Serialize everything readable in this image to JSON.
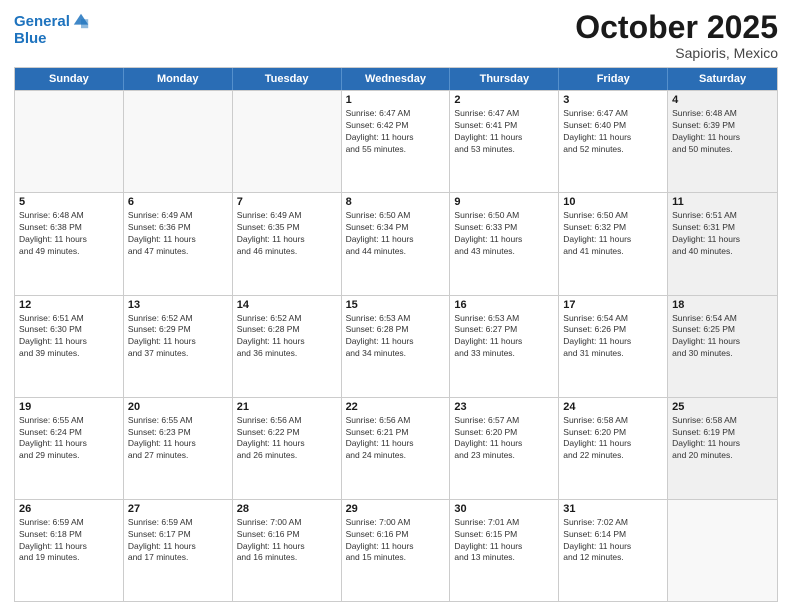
{
  "header": {
    "logo_line1": "General",
    "logo_line2": "Blue",
    "title": "October 2025",
    "subtitle": "Sapioris, Mexico"
  },
  "days_of_week": [
    "Sunday",
    "Monday",
    "Tuesday",
    "Wednesday",
    "Thursday",
    "Friday",
    "Saturday"
  ],
  "weeks": [
    [
      {
        "day": "",
        "info": "",
        "empty": true
      },
      {
        "day": "",
        "info": "",
        "empty": true
      },
      {
        "day": "",
        "info": "",
        "empty": true
      },
      {
        "day": "1",
        "info": "Sunrise: 6:47 AM\nSunset: 6:42 PM\nDaylight: 11 hours\nand 55 minutes."
      },
      {
        "day": "2",
        "info": "Sunrise: 6:47 AM\nSunset: 6:41 PM\nDaylight: 11 hours\nand 53 minutes."
      },
      {
        "day": "3",
        "info": "Sunrise: 6:47 AM\nSunset: 6:40 PM\nDaylight: 11 hours\nand 52 minutes."
      },
      {
        "day": "4",
        "info": "Sunrise: 6:48 AM\nSunset: 6:39 PM\nDaylight: 11 hours\nand 50 minutes.",
        "shaded": true
      }
    ],
    [
      {
        "day": "5",
        "info": "Sunrise: 6:48 AM\nSunset: 6:38 PM\nDaylight: 11 hours\nand 49 minutes."
      },
      {
        "day": "6",
        "info": "Sunrise: 6:49 AM\nSunset: 6:36 PM\nDaylight: 11 hours\nand 47 minutes."
      },
      {
        "day": "7",
        "info": "Sunrise: 6:49 AM\nSunset: 6:35 PM\nDaylight: 11 hours\nand 46 minutes."
      },
      {
        "day": "8",
        "info": "Sunrise: 6:50 AM\nSunset: 6:34 PM\nDaylight: 11 hours\nand 44 minutes."
      },
      {
        "day": "9",
        "info": "Sunrise: 6:50 AM\nSunset: 6:33 PM\nDaylight: 11 hours\nand 43 minutes."
      },
      {
        "day": "10",
        "info": "Sunrise: 6:50 AM\nSunset: 6:32 PM\nDaylight: 11 hours\nand 41 minutes."
      },
      {
        "day": "11",
        "info": "Sunrise: 6:51 AM\nSunset: 6:31 PM\nDaylight: 11 hours\nand 40 minutes.",
        "shaded": true
      }
    ],
    [
      {
        "day": "12",
        "info": "Sunrise: 6:51 AM\nSunset: 6:30 PM\nDaylight: 11 hours\nand 39 minutes."
      },
      {
        "day": "13",
        "info": "Sunrise: 6:52 AM\nSunset: 6:29 PM\nDaylight: 11 hours\nand 37 minutes."
      },
      {
        "day": "14",
        "info": "Sunrise: 6:52 AM\nSunset: 6:28 PM\nDaylight: 11 hours\nand 36 minutes."
      },
      {
        "day": "15",
        "info": "Sunrise: 6:53 AM\nSunset: 6:28 PM\nDaylight: 11 hours\nand 34 minutes."
      },
      {
        "day": "16",
        "info": "Sunrise: 6:53 AM\nSunset: 6:27 PM\nDaylight: 11 hours\nand 33 minutes."
      },
      {
        "day": "17",
        "info": "Sunrise: 6:54 AM\nSunset: 6:26 PM\nDaylight: 11 hours\nand 31 minutes."
      },
      {
        "day": "18",
        "info": "Sunrise: 6:54 AM\nSunset: 6:25 PM\nDaylight: 11 hours\nand 30 minutes.",
        "shaded": true
      }
    ],
    [
      {
        "day": "19",
        "info": "Sunrise: 6:55 AM\nSunset: 6:24 PM\nDaylight: 11 hours\nand 29 minutes."
      },
      {
        "day": "20",
        "info": "Sunrise: 6:55 AM\nSunset: 6:23 PM\nDaylight: 11 hours\nand 27 minutes."
      },
      {
        "day": "21",
        "info": "Sunrise: 6:56 AM\nSunset: 6:22 PM\nDaylight: 11 hours\nand 26 minutes."
      },
      {
        "day": "22",
        "info": "Sunrise: 6:56 AM\nSunset: 6:21 PM\nDaylight: 11 hours\nand 24 minutes."
      },
      {
        "day": "23",
        "info": "Sunrise: 6:57 AM\nSunset: 6:20 PM\nDaylight: 11 hours\nand 23 minutes."
      },
      {
        "day": "24",
        "info": "Sunrise: 6:58 AM\nSunset: 6:20 PM\nDaylight: 11 hours\nand 22 minutes."
      },
      {
        "day": "25",
        "info": "Sunrise: 6:58 AM\nSunset: 6:19 PM\nDaylight: 11 hours\nand 20 minutes.",
        "shaded": true
      }
    ],
    [
      {
        "day": "26",
        "info": "Sunrise: 6:59 AM\nSunset: 6:18 PM\nDaylight: 11 hours\nand 19 minutes."
      },
      {
        "day": "27",
        "info": "Sunrise: 6:59 AM\nSunset: 6:17 PM\nDaylight: 11 hours\nand 17 minutes."
      },
      {
        "day": "28",
        "info": "Sunrise: 7:00 AM\nSunset: 6:16 PM\nDaylight: 11 hours\nand 16 minutes."
      },
      {
        "day": "29",
        "info": "Sunrise: 7:00 AM\nSunset: 6:16 PM\nDaylight: 11 hours\nand 15 minutes."
      },
      {
        "day": "30",
        "info": "Sunrise: 7:01 AM\nSunset: 6:15 PM\nDaylight: 11 hours\nand 13 minutes."
      },
      {
        "day": "31",
        "info": "Sunrise: 7:02 AM\nSunset: 6:14 PM\nDaylight: 11 hours\nand 12 minutes."
      },
      {
        "day": "",
        "info": "",
        "empty": true,
        "shaded": true
      }
    ]
  ]
}
